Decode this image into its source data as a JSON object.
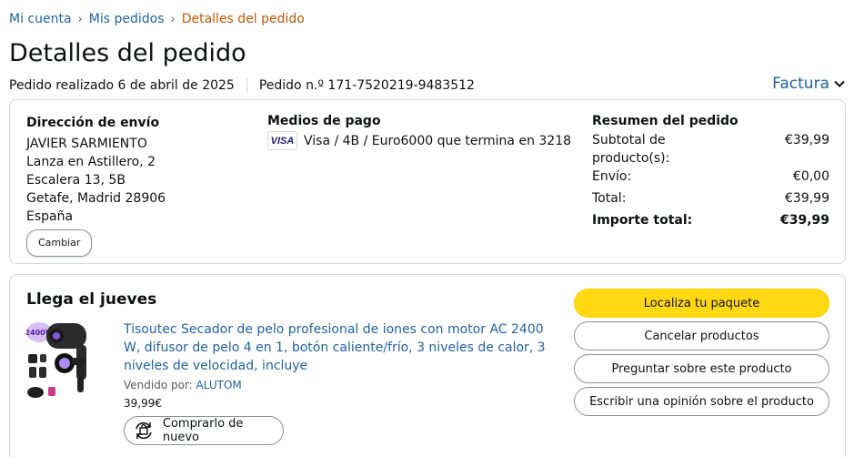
{
  "breadcrumb": {
    "items": [
      "Mi cuenta",
      "Mis pedidos"
    ],
    "current": "Detalles del pedido",
    "separator": "›"
  },
  "page_title": "Detalles del pedido",
  "order": {
    "placed": "Pedido realizado 6 de abril de 2025",
    "number": "Pedido n.º 171-7520219-9483512",
    "invoice_label": "Factura"
  },
  "shipping": {
    "title": "Dirección de envío",
    "lines": [
      "JAVIER SARMIENTO",
      "Lanza en Astillero, 2",
      "Escalera 13, 5B",
      "Getafe, Madrid 28906",
      "España"
    ],
    "change_label": "Cambiar"
  },
  "payment": {
    "title": "Medios de pago",
    "card_logo": "VISA",
    "card_text": "Visa / 4B / Euro6000  que termina en 3218"
  },
  "summary": {
    "title": "Resumen del pedido",
    "rows": [
      {
        "label": "Subtotal de producto(s):",
        "value": "€39,99"
      },
      {
        "label": "Envío:",
        "value": "€0,00"
      },
      {
        "label": "Total:",
        "value": "€39,99"
      }
    ],
    "grand_total": {
      "label": "Importe total:",
      "value": "€39,99"
    }
  },
  "shipment": {
    "arrival": "Llega el jueves",
    "product": {
      "title": "Tisoutec Secador de pelo profesional de iones con motor AC 2400 W, difusor de pelo 4 en 1, botón caliente/frío, 3 niveles de calor, 3 niveles de velocidad, incluye",
      "sold_by_label": "Vendido por:",
      "seller": "ALUTOM",
      "price": "39,99€",
      "thumb_badge": "2400W",
      "buy_again_label": "Comprarlo de nuevo"
    },
    "actions": {
      "track": "Localiza tu paquete",
      "cancel": "Cancelar productos",
      "ask": "Preguntar sobre este producto",
      "review": "Escribir una opinión sobre el producto"
    }
  },
  "colors": {
    "link": "#2162a1",
    "breadcrumb_current": "#c45500",
    "primary_button": "#ffd814",
    "border": "#d5d9d9"
  }
}
